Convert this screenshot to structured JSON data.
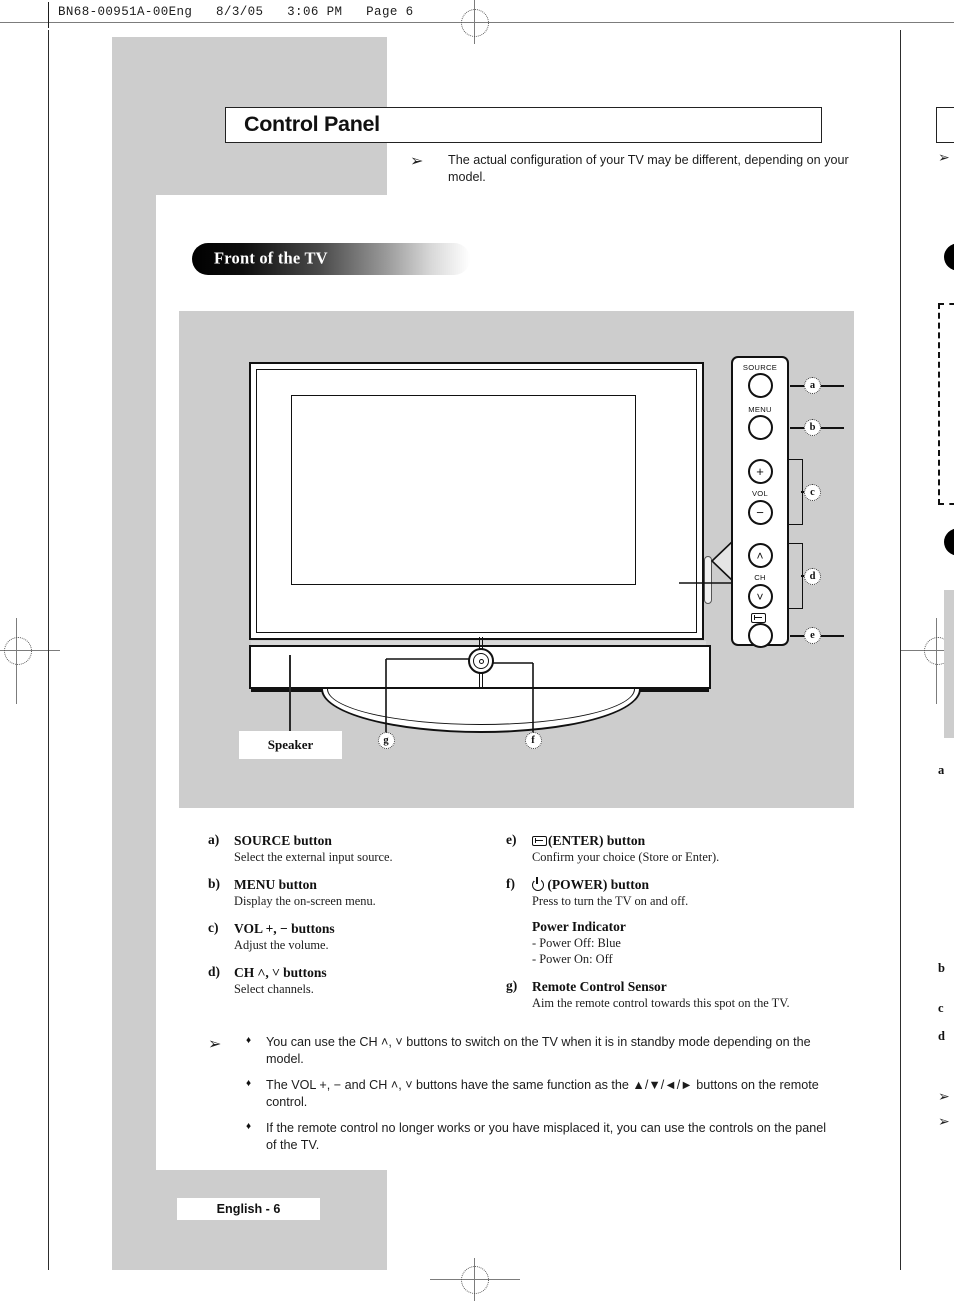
{
  "scan": {
    "header": "BN68-00951A-00Eng   8/3/05   3:06 PM   Page 6"
  },
  "title": {
    "heading": "Control Panel"
  },
  "top_note": {
    "arrow": "➢",
    "text": "The actual configuration of your TV may be different, depending on your model."
  },
  "section": {
    "pill_label": "Front of the TV"
  },
  "diagram": {
    "pod_labels": {
      "source": "SOURCE",
      "menu": "MENU",
      "vol": "VOL",
      "ch": "CH",
      "plus": "+",
      "minus": "−",
      "ch_up": "˄",
      "ch_down": "˅"
    },
    "callouts": {
      "a": "a",
      "b": "b",
      "c": "c",
      "d": "d",
      "e": "e",
      "f": "f",
      "g": "g"
    },
    "speaker_label": "Speaker"
  },
  "legend": {
    "left": [
      {
        "key": "a)",
        "head": "SOURCE button",
        "sub": "Select the external input source."
      },
      {
        "key": "b)",
        "head": "MENU button",
        "sub": "Display the on-screen menu."
      },
      {
        "key": "c)",
        "head": "VOL +, −  buttons",
        "sub": "Adjust the volume."
      },
      {
        "key": "d)",
        "head": "CH ˄, ˅ buttons",
        "sub": "Select channels."
      }
    ],
    "right": [
      {
        "key": "e)",
        "head_icon": "enter-icon",
        "head": "(ENTER) button",
        "sub": "Confirm your choice (Store or Enter)."
      },
      {
        "key": "f)",
        "head_icon": "power-icon",
        "head": "(POWER) button",
        "sub": "Press to turn the TV on and off.",
        "sub_head": "Power Indicator",
        "sub_lines": [
          "- Power Off: Blue",
          "- Power On: Off"
        ]
      },
      {
        "key": "g)",
        "head": "Remote Control Sensor",
        "sub": "Aim the remote control towards this spot on the TV."
      }
    ]
  },
  "notes": {
    "arrow": "➢",
    "bullet": "♦",
    "items": [
      {
        "pre": "You can use the ",
        "b1": "CH",
        "mid": " ˄, ˅ buttons to switch on the TV when it is in standby mode depending on the model.",
        "full": "You can use the CH ˄, ˅ buttons to switch on the TV when it is in standby mode depending on the model."
      },
      {
        "full": "The VOL +, − and CH ˄, ˅ buttons have the same function as the ▲/▼/◄/► buttons on the remote control."
      },
      {
        "full": "If the remote control no longer works or you have misplaced it, you can use the controls on the panel of the TV."
      }
    ]
  },
  "footer": {
    "page_label": "English - 6"
  },
  "bleed": {
    "letters": [
      "a",
      "b",
      "c",
      "d"
    ],
    "arrows": [
      "➢",
      "➢"
    ]
  }
}
